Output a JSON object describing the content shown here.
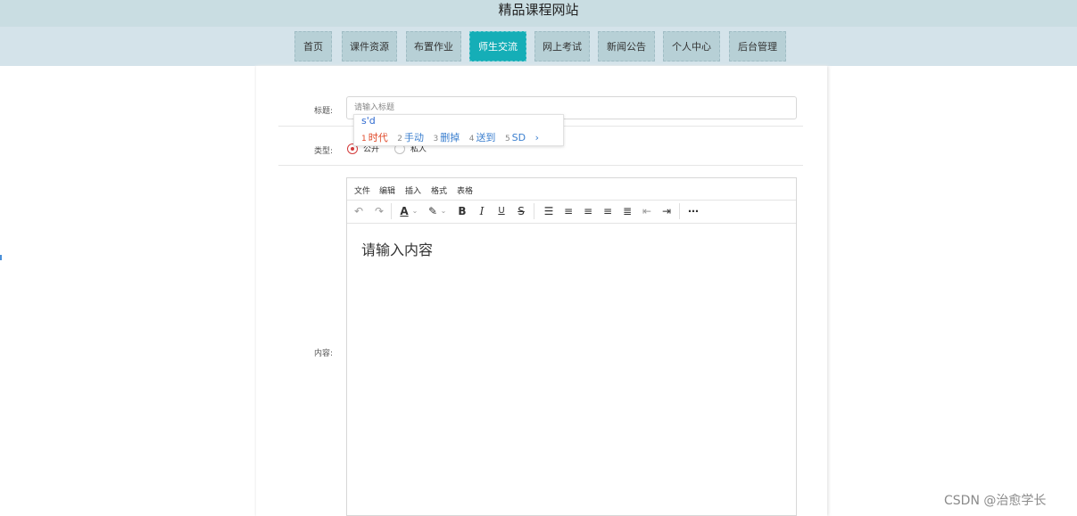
{
  "site": {
    "title": "精品课程网站"
  },
  "nav": {
    "items": [
      {
        "label": "首页"
      },
      {
        "label": "课件资源"
      },
      {
        "label": "布置作业"
      },
      {
        "label": "师生交流"
      },
      {
        "label": "网上考试"
      },
      {
        "label": "新闻公告"
      },
      {
        "label": "个人中心"
      },
      {
        "label": "后台管理"
      }
    ],
    "active": "师生交流"
  },
  "form": {
    "title_label": "标题:",
    "title_placeholder": "请输入标题",
    "type_label": "类型:",
    "type_options": [
      {
        "label": "公开",
        "checked": true
      },
      {
        "label": "私人",
        "checked": false
      }
    ],
    "content_label": "内容:"
  },
  "ime": {
    "composition": "s'd",
    "candidates": [
      {
        "num": "1",
        "text": "时代"
      },
      {
        "num": "2",
        "text": "手动"
      },
      {
        "num": "3",
        "text": "删掉"
      },
      {
        "num": "4",
        "text": "送到"
      },
      {
        "num": "5",
        "text": "SD"
      }
    ],
    "next": "›"
  },
  "editor": {
    "menus": [
      "文件",
      "编辑",
      "插入",
      "格式",
      "表格"
    ],
    "toolbar_icons": [
      "undo-icon",
      "redo-icon",
      "font-color-icon",
      "highlight-icon",
      "bold-icon",
      "italic-icon",
      "underline-icon",
      "strikethrough-icon",
      "list-icon",
      "align-left-icon",
      "align-center-icon",
      "align-right-icon",
      "align-justify-icon",
      "outdent-icon",
      "indent-icon",
      "more-icon"
    ],
    "placeholder": "请输入内容"
  },
  "watermark": "CSDN @治愈学长",
  "colors": {
    "active_tab": "#15aeb7",
    "radio_checked": "#d33b3b"
  }
}
